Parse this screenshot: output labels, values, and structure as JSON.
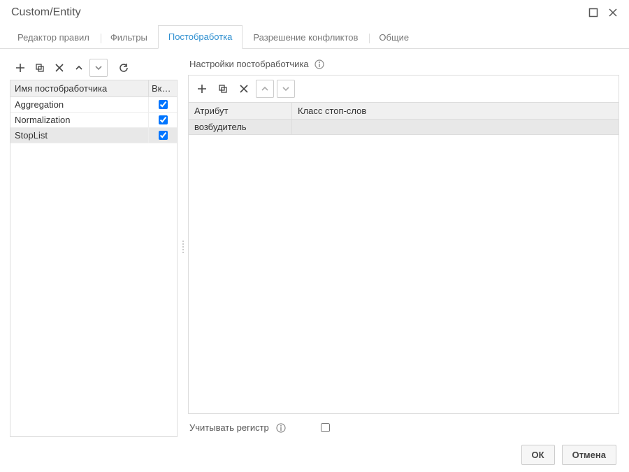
{
  "window": {
    "title": "Custom/Entity"
  },
  "tabs": [
    {
      "label": "Редактор правил",
      "active": false
    },
    {
      "label": "Фильтры",
      "active": false
    },
    {
      "label": "Постобработка",
      "active": true
    },
    {
      "label": "Разрешение конфликтов",
      "active": false
    },
    {
      "label": "Общие",
      "active": false
    }
  ],
  "left": {
    "headers": {
      "name": "Имя постобработчика",
      "enabled": "Вкл…"
    },
    "rows": [
      {
        "name": "Aggregation",
        "enabled": true,
        "selected": false
      },
      {
        "name": "Normalization",
        "enabled": true,
        "selected": false
      },
      {
        "name": "StopList",
        "enabled": true,
        "selected": true
      }
    ]
  },
  "right": {
    "settings_title": "Настройки постобработчика",
    "attr_headers": {
      "attribute": "Атрибут",
      "class": "Класс стоп-слов"
    },
    "attr_rows": [
      {
        "attribute": "возбудитель",
        "class": ""
      }
    ],
    "case_label": "Учитывать регистр",
    "case_checked": false
  },
  "footer": {
    "ok": "ОК",
    "cancel": "Отмена"
  },
  "icons": {
    "plus": "plus",
    "duplicate": "duplicate",
    "delete_x": "x",
    "up": "chevron-up",
    "down": "chevron-down",
    "refresh": "refresh",
    "maximize": "square",
    "close": "x",
    "info": "info"
  }
}
